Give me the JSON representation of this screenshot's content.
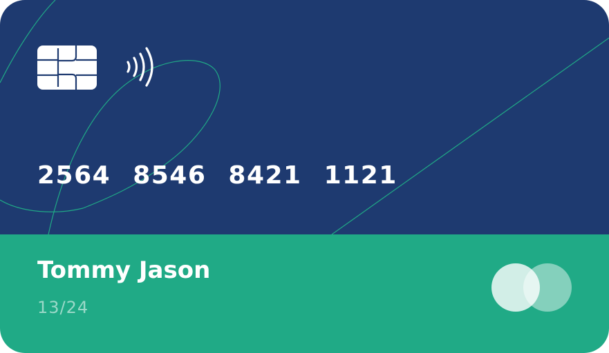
{
  "colors": {
    "card_top": "#1e3a70",
    "card_bottom": "#20aa86",
    "accent_line": "#20aa86",
    "chip": "#ffffff",
    "logo_left": "rgba(255,255,255,0.8)",
    "logo_right": "rgba(255,255,255,0.45)"
  },
  "card": {
    "number_groups": [
      "2564",
      "8546",
      "8421",
      "1121"
    ],
    "holder_name": "Tommy Jason",
    "expiry": "13/24"
  },
  "icons": {
    "chip": "chip-icon",
    "contactless": "contactless-icon",
    "brand": "card-brand-logo"
  }
}
